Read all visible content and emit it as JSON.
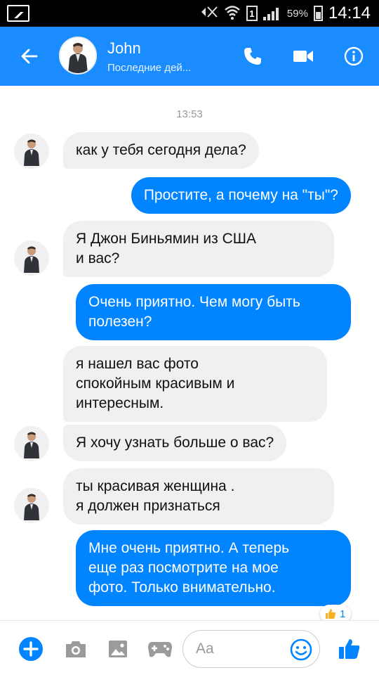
{
  "status_bar": {
    "battery": "59%",
    "time": "14:14",
    "sim": "1"
  },
  "header": {
    "name": "John",
    "status": "Последние дей..."
  },
  "chat": {
    "timestamp": "13:53",
    "messages": [
      {
        "direction": "incoming",
        "text": "как у тебя сегодня дела?",
        "avatar": true
      },
      {
        "direction": "outgoing",
        "text": "Простите, а почему на \"ты\"?"
      },
      {
        "direction": "incoming",
        "text": "Я Джон Биньямин из США\nи вас?",
        "avatar": true
      },
      {
        "direction": "outgoing",
        "text": "Очень приятно. Чем могу быть\nполезен?"
      },
      {
        "direction": "incoming",
        "text": "я нашел вас фото\nспокойным красивым и\nинтересным.",
        "avatar": false
      },
      {
        "direction": "incoming",
        "text": "Я хочу узнать больше о вас?",
        "avatar": true
      },
      {
        "direction": "incoming",
        "text": "ты красивая женщина .\nя должен признаться",
        "avatar": true
      },
      {
        "direction": "outgoing",
        "text": "Мне очень приятно. А теперь\nеще раз посмотрите на мое\nфото. Только внимательно."
      }
    ],
    "reaction": {
      "icon": "thumbs-up-icon",
      "count": "1"
    }
  },
  "composer": {
    "placeholder": "Aa"
  },
  "colors": {
    "header_bg": "#1a8cff",
    "outgoing_bubble": "#0084ff",
    "incoming_bubble": "#f1f0f0",
    "accent": "#0084ff"
  }
}
